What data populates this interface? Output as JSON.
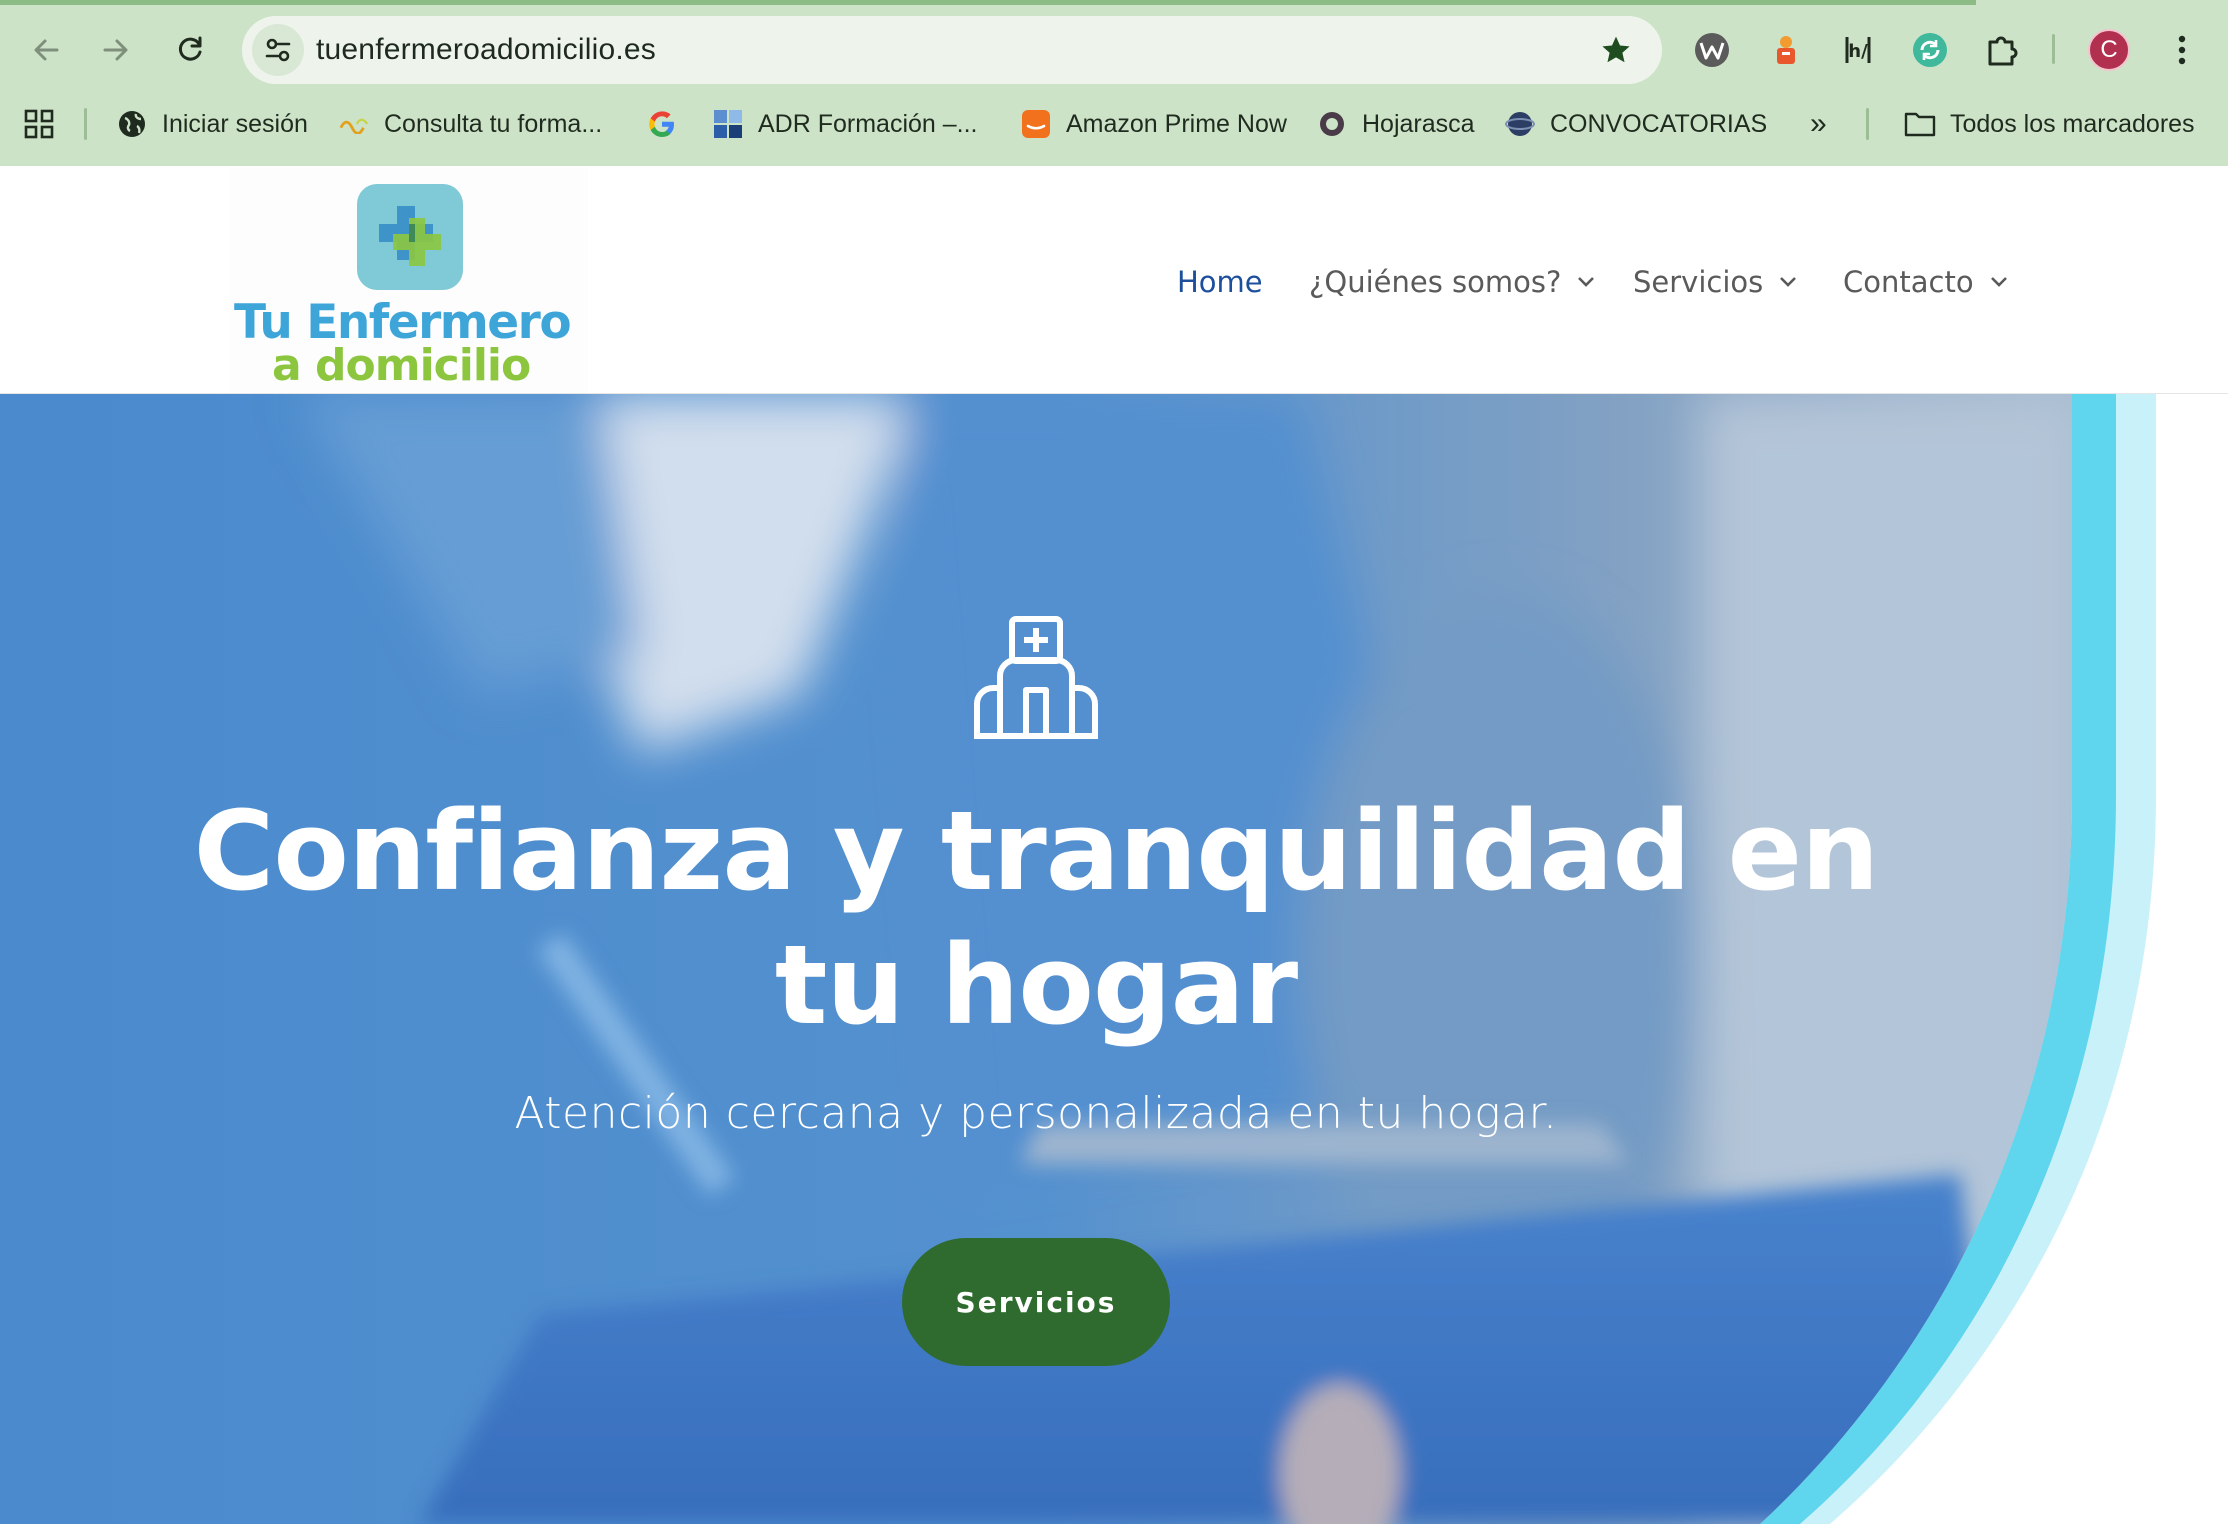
{
  "browser": {
    "url": "tuenfermeroadomicilio.es",
    "avatar_letter": "C",
    "bookmarks": [
      {
        "label": "Iniciar sesión",
        "icon": "globe-icon"
      },
      {
        "label": "Consulta tu forma...",
        "icon": "link-icon"
      },
      {
        "label": "",
        "icon": "google-icon"
      },
      {
        "label": "ADR Formación –...",
        "icon": "adr-icon"
      },
      {
        "label": "Amazon Prime Now",
        "icon": "amazon-icon"
      },
      {
        "label": "Hojarasca",
        "icon": "circle-icon"
      },
      {
        "label": "CONVOCATORIAS",
        "icon": "planet-icon"
      }
    ],
    "all_bookmarks": "Todos los marcadores",
    "overflow": "»"
  },
  "site": {
    "logo": {
      "line1": "Tu Enfermero",
      "line2": "a domicilio"
    },
    "nav": [
      {
        "label": "Home",
        "active": true
      },
      {
        "label": "¿Quiénes somos?",
        "dropdown": true
      },
      {
        "label": "Servicios",
        "dropdown": true
      },
      {
        "label": "Contacto",
        "dropdown": true
      }
    ],
    "hero": {
      "icon": "hospital-icon",
      "title_line1": "Confianza y tranquilidad en",
      "title_line2": "tu hogar",
      "subtitle": "Atención cercana y personalizada en tu hogar.",
      "button": "Servicios"
    }
  },
  "colors": {
    "chrome": "#cde3c8",
    "nav_active": "#1c4f9c",
    "button_green": "#2f6b2e",
    "logo_blue": "#3ea5d9",
    "logo_green": "#8cc63f",
    "accent_cyan": "#5fd6ee"
  }
}
